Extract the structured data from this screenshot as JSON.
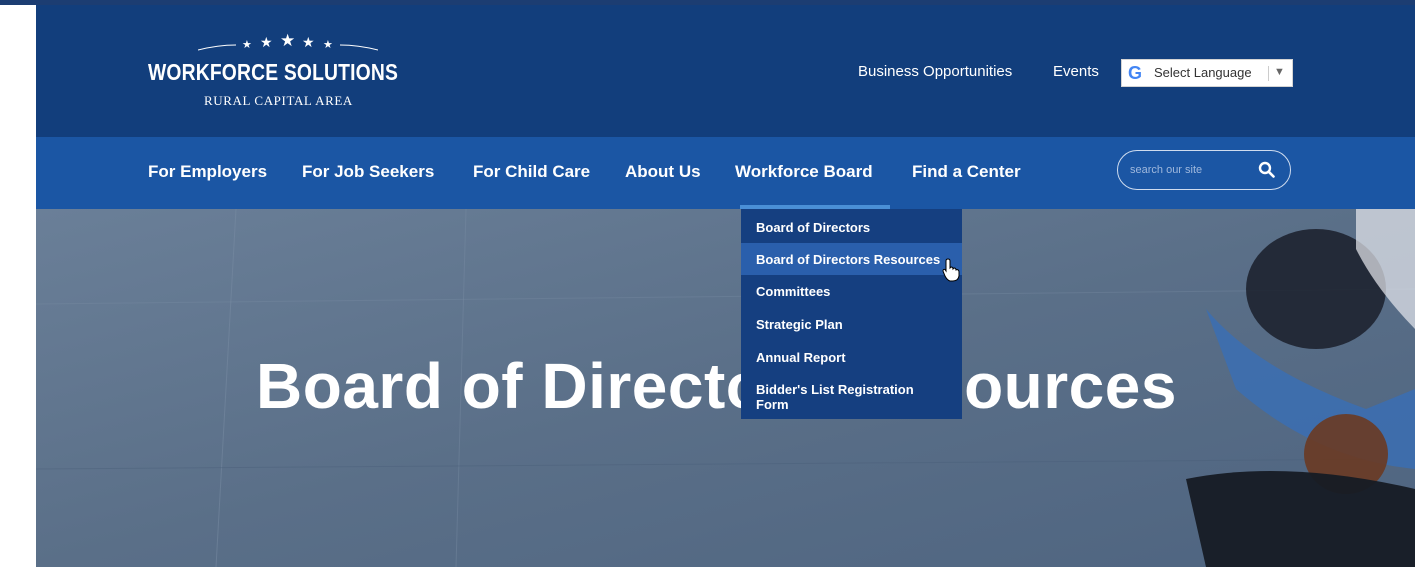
{
  "header": {
    "logo": {
      "main": "WORKFORCE SOLUTIONS",
      "sub": "RURAL CAPITAL AREA"
    },
    "utility_links": [
      "Business Opportunities",
      "Events"
    ],
    "translate": {
      "icon": "google-g-icon",
      "label": "Select Language",
      "arrow": "▼"
    }
  },
  "nav": {
    "items": [
      "For Employers",
      "For Job Seekers",
      "For Child Care",
      "About Us",
      "Workforce Board",
      "Find a Center"
    ],
    "active_index": 4,
    "search": {
      "placeholder": "search our site",
      "icon": "search-icon"
    }
  },
  "dropdown": {
    "items": [
      "Board of Directors",
      "Board of Directors Resources",
      "Committees",
      "Strategic Plan",
      "Annual Report",
      "Bidder's List Registration Form"
    ],
    "hover_index": 1
  },
  "hero": {
    "title": "Board of Directors Resources"
  },
  "colors": {
    "header_bg": "#123e7c",
    "nav_bg": "#1b56a4",
    "dropdown_bg": "#153f80",
    "dropdown_hover": "#2a5fac"
  }
}
